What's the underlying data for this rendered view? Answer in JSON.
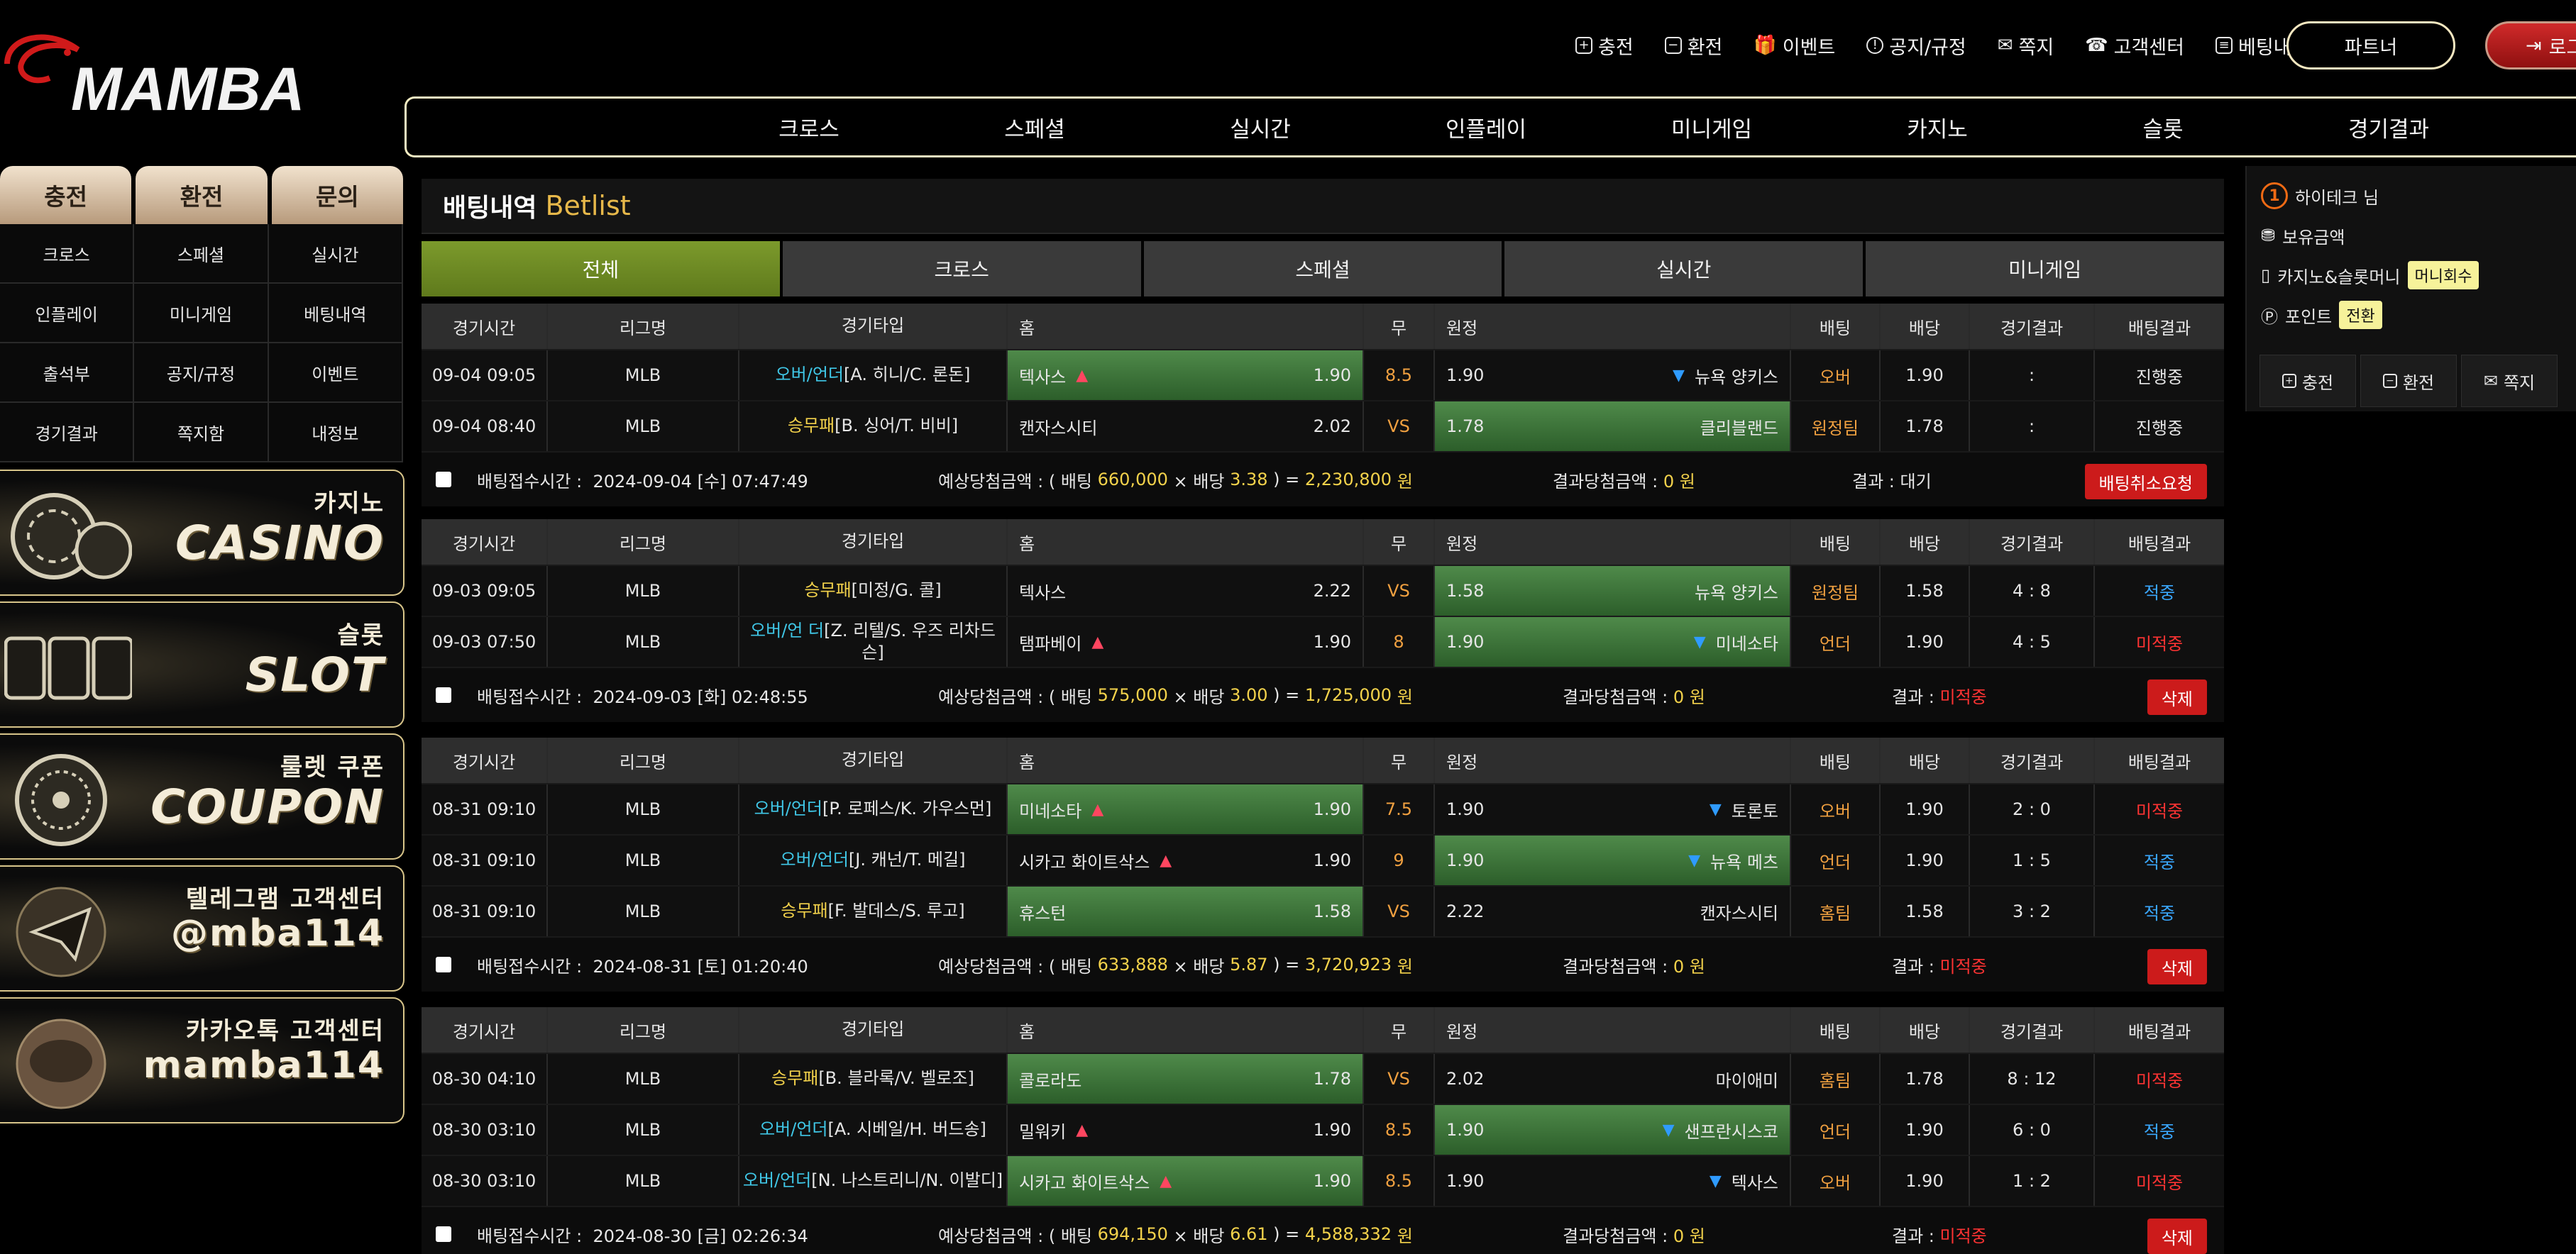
{
  "brand": {
    "logo_text": "MAMBA"
  },
  "header": {
    "links": [
      {
        "label": "충전",
        "icon": "plus-square-icon"
      },
      {
        "label": "환전",
        "icon": "minus-square-icon"
      },
      {
        "label": "이벤트",
        "icon": "gift-icon"
      },
      {
        "label": "공지/규정",
        "icon": "info-circle-icon"
      },
      {
        "label": "쪽지",
        "icon": "envelope-icon"
      },
      {
        "label": "고객센터",
        "icon": "headset-icon"
      },
      {
        "label": "베팅내역",
        "icon": "list-icon"
      }
    ],
    "partner_label": "파트너",
    "logout_label": "로그"
  },
  "main_nav": [
    "크로스",
    "스페셜",
    "실시간",
    "인플레이",
    "미니게임",
    "카지노",
    "슬롯",
    "경기결과"
  ],
  "sidebar": {
    "tabs": [
      "충전",
      "환전",
      "문의"
    ],
    "grid": [
      "크로스",
      "스페셜",
      "실시간",
      "인플레이",
      "미니게임",
      "베팅내역",
      "출석부",
      "공지/규정",
      "이벤트",
      "경기결과",
      "쪽지함",
      "내정보"
    ],
    "banners": [
      {
        "sub": "카지노",
        "main": "CASINO",
        "icon": "casino-chips-icon"
      },
      {
        "sub": "슬롯",
        "main": "SLOT",
        "icon": "slot-777-icon"
      },
      {
        "sub": "룰렛 쿠폰",
        "main": "COUPON",
        "icon": "roulette-icon"
      },
      {
        "sub": "텔레그램 고객센터",
        "main": "@mba114",
        "icon": "telegram-icon"
      },
      {
        "sub": "카카오톡 고객센터",
        "main": "mamba114",
        "icon": "kakaotalk-icon"
      }
    ]
  },
  "panel": {
    "title_ko": "배팅내역",
    "title_en": "Betlist",
    "tabs": [
      "전체",
      "크로스",
      "스페셜",
      "실시간",
      "미니게임"
    ],
    "active_tab": "전체",
    "columns": [
      "경기시간",
      "리그명",
      "경기타입",
      "홈",
      "무",
      "원정",
      "배팅",
      "배당",
      "경기결과",
      "배팅결과"
    ]
  },
  "bets": [
    {
      "games": [
        {
          "time": "09-04 09:05",
          "league": "MLB",
          "type_kind": "오버/언더",
          "type_rest": "[A. 히니/C. 론돈]",
          "home": "텍사스",
          "home_mark": "▲",
          "home_odds": "1.90",
          "draw": "8.5",
          "away_odds": "1.90",
          "away": "뉴욕 양키스",
          "away_mark": "▼",
          "pick": "오버",
          "odds": "1.90",
          "score": ":",
          "result": "진행중",
          "highlight": "home",
          "type_color": "cyan",
          "result_color": "white"
        },
        {
          "time": "09-04 08:40",
          "league": "MLB",
          "type_kind": "승무패",
          "type_rest": "[B. 싱어/T. 비비]",
          "home": "캔자스시티",
          "home_mark": "",
          "home_odds": "2.02",
          "draw": "VS",
          "away_odds": "1.78",
          "away": "클리블랜드",
          "away_mark": "",
          "pick": "원정팀",
          "odds": "1.78",
          "score": ":",
          "result": "진행중",
          "highlight": "away",
          "type_color": "yellow",
          "result_color": "white"
        }
      ],
      "time_label": "배팅접수시간 :",
      "bet_time": "2024-09-04 [수] 07:47:49",
      "exp_prefix": "예상당첨금액 : ( 배팅",
      "amount": "660,000",
      "times": "× 배당",
      "total_odds": "3.38",
      "eq": ") =",
      "payout": "2,230,800",
      "won": "원",
      "win_label": "결과당첨금액 :",
      "win_amount": "0 원",
      "result_label": "결과 :",
      "result_value": "대기",
      "result_color": "white",
      "button": "배팅취소요청"
    },
    {
      "games": [
        {
          "time": "09-03 09:05",
          "league": "MLB",
          "type_kind": "승무패",
          "type_rest": "[미정/G. 콜]",
          "home": "텍사스",
          "home_mark": "",
          "home_odds": "2.22",
          "draw": "VS",
          "away_odds": "1.58",
          "away": "뉴욕 양키스",
          "away_mark": "",
          "pick": "원정팀",
          "odds": "1.58",
          "score": "4 : 8",
          "result": "적중",
          "highlight": "away",
          "type_color": "yellow",
          "result_color": "blue"
        },
        {
          "time": "09-03 07:50",
          "league": "MLB",
          "type_kind": "오버/언 더",
          "type_rest": "[Z. 리텔/S. 우즈 리차드슨]",
          "home": "탬파베이",
          "home_mark": "▲",
          "home_odds": "1.90",
          "draw": "8",
          "away_odds": "1.90",
          "away": "미네소타",
          "away_mark": "▼",
          "pick": "언더",
          "odds": "1.90",
          "score": "4 : 5",
          "result": "미적중",
          "highlight": "away",
          "type_color": "cyan",
          "result_color": "red"
        }
      ],
      "time_label": "배팅접수시간 :",
      "bet_time": "2024-09-03 [화] 02:48:55",
      "exp_prefix": "예상당첨금액 : ( 배팅",
      "amount": "575,000",
      "times": "× 배당",
      "total_odds": "3.00",
      "eq": ") =",
      "payout": "1,725,000",
      "won": "원",
      "win_label": "결과당첨금액 :",
      "win_amount": "0 원",
      "result_label": "결과 :",
      "result_value": "미적중",
      "result_color": "red",
      "button": "삭제"
    },
    {
      "games": [
        {
          "time": "08-31 09:10",
          "league": "MLB",
          "type_kind": "오버/언더",
          "type_rest": "[P. 로페스/K. 가우스먼]",
          "home": "미네소타",
          "home_mark": "▲",
          "home_odds": "1.90",
          "draw": "7.5",
          "away_odds": "1.90",
          "away": "토론토",
          "away_mark": "▼",
          "pick": "오버",
          "odds": "1.90",
          "score": "2 : 0",
          "result": "미적중",
          "highlight": "home",
          "type_color": "cyan",
          "result_color": "red"
        },
        {
          "time": "08-31 09:10",
          "league": "MLB",
          "type_kind": "오버/언더",
          "type_rest": "[J. 캐넌/T. 메길]",
          "home": "시카고 화이트삭스",
          "home_mark": "▲",
          "home_odds": "1.90",
          "draw": "9",
          "away_odds": "1.90",
          "away": "뉴욕 메츠",
          "away_mark": "▼",
          "pick": "언더",
          "odds": "1.90",
          "score": "1 : 5",
          "result": "적중",
          "highlight": "away",
          "type_color": "cyan",
          "result_color": "blue"
        },
        {
          "time": "08-31 09:10",
          "league": "MLB",
          "type_kind": "승무패",
          "type_rest": "[F. 발데스/S. 루고]",
          "home": "휴스턴",
          "home_mark": "",
          "home_odds": "1.58",
          "draw": "VS",
          "away_odds": "2.22",
          "away": "캔자스시티",
          "away_mark": "",
          "pick": "홈팀",
          "odds": "1.58",
          "score": "3 : 2",
          "result": "적중",
          "highlight": "home",
          "type_color": "yellow",
          "result_color": "blue"
        }
      ],
      "time_label": "배팅접수시간 :",
      "bet_time": "2024-08-31 [토] 01:20:40",
      "exp_prefix": "예상당첨금액 : ( 배팅",
      "amount": "633,888",
      "times": "× 배당",
      "total_odds": "5.87",
      "eq": ") =",
      "payout": "3,720,923",
      "won": "원",
      "win_label": "결과당첨금액 :",
      "win_amount": "0 원",
      "result_label": "결과 :",
      "result_value": "미적중",
      "result_color": "red",
      "button": "삭제"
    },
    {
      "games": [
        {
          "time": "08-30 04:10",
          "league": "MLB",
          "type_kind": "승무패",
          "type_rest": "[B. 블라록/V. 벨로조]",
          "home": "콜로라도",
          "home_mark": "",
          "home_odds": "1.78",
          "draw": "VS",
          "away_odds": "2.02",
          "away": "마이애미",
          "away_mark": "",
          "pick": "홈팀",
          "odds": "1.78",
          "score": "8 : 12",
          "result": "미적중",
          "highlight": "home",
          "type_color": "yellow",
          "result_color": "red"
        },
        {
          "time": "08-30 03:10",
          "league": "MLB",
          "type_kind": "오버/언더",
          "type_rest": "[A. 시베일/H. 버드송]",
          "home": "밀워키",
          "home_mark": "▲",
          "home_odds": "1.90",
          "draw": "8.5",
          "away_odds": "1.90",
          "away": "샌프란시스코",
          "away_mark": "▼",
          "pick": "언더",
          "odds": "1.90",
          "score": "6 : 0",
          "result": "적중",
          "highlight": "away",
          "type_color": "cyan",
          "result_color": "blue"
        },
        {
          "time": "08-30 03:10",
          "league": "MLB",
          "type_kind": "오버/언더",
          "type_rest": "[N. 나스트리니/N. 이발디]",
          "home": "시카고 화이트삭스",
          "home_mark": "▲",
          "home_odds": "1.90",
          "draw": "8.5",
          "away_odds": "1.90",
          "away": "텍사스",
          "away_mark": "▼",
          "pick": "오버",
          "odds": "1.90",
          "score": "1 : 2",
          "result": "미적중",
          "highlight": "home",
          "type_color": "cyan",
          "result_color": "red"
        }
      ],
      "time_label": "배팅접수시간 :",
      "bet_time": "2024-08-30 [금] 02:26:34",
      "exp_prefix": "예상당첨금액 : ( 배팅",
      "amount": "694,150",
      "times": "× 배당",
      "total_odds": "6.61",
      "eq": ") =",
      "payout": "4,588,332",
      "won": "원",
      "win_label": "결과당첨금액 :",
      "win_amount": "0 원",
      "result_label": "결과 :",
      "result_value": "미적중",
      "result_color": "red",
      "button": "삭제"
    }
  ],
  "user": {
    "level": "1",
    "name": "하이테크 님",
    "balance_label": "보유금액",
    "casino_label": "카지노&슬롯머니",
    "casino_button": "머니회수",
    "point_label": "포인트",
    "point_button": "전환",
    "buttons": [
      "충전",
      "환전",
      "쪽지"
    ]
  },
  "colors": {
    "accent_gold": "#e7b84a",
    "win_blue": "#3aa8ff",
    "lose_red": "#ff3333",
    "active_tab": "#6f8c24",
    "highlight_green": "#3f7a3a"
  }
}
